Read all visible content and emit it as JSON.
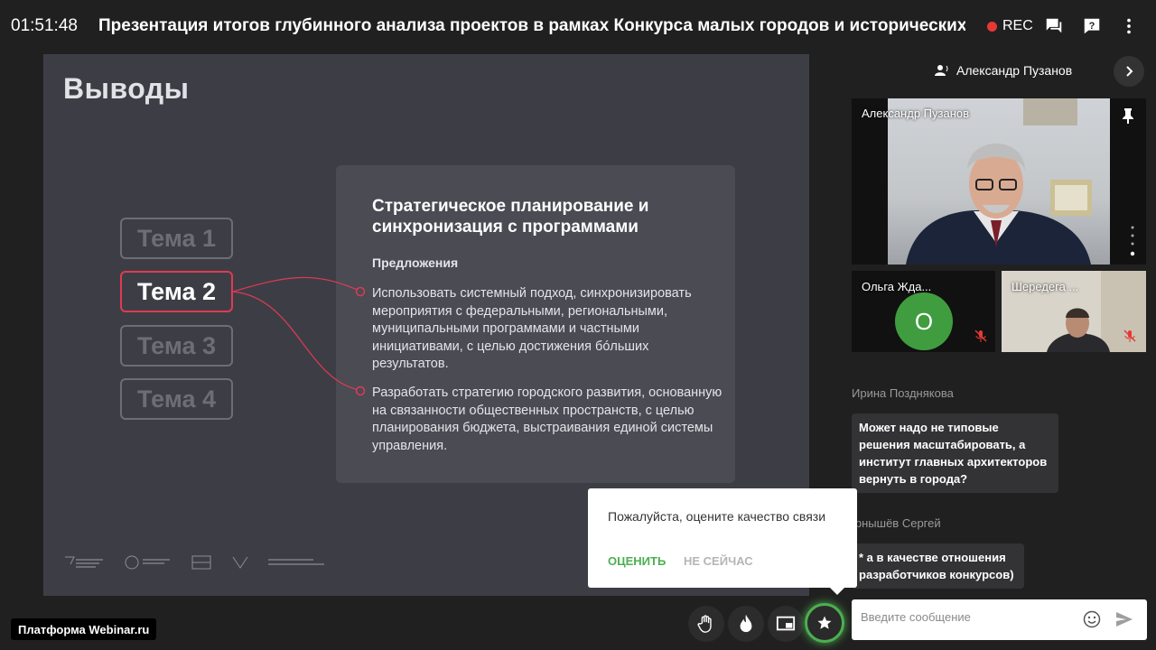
{
  "header": {
    "timer": "01:51:48",
    "title": "Презентация итогов глубинного анализа проектов в рамках Конкурса малых городов и исторических пос",
    "rec_label": "REC"
  },
  "slide": {
    "heading": "Выводы",
    "themes": [
      "Тема 1",
      "Тема 2",
      "Тема 3",
      "Тема 4"
    ],
    "active_theme": "Тема 2",
    "card": {
      "title": "Стратегическое планирование и синхронизация с программами",
      "subtitle": "Предложения",
      "proposals": [
        "Использовать системный подход, синхронизировать мероприятия с федеральными, региональными, муниципальными программами и частными инициативами, с целью достижения бóльших результатов.",
        "Разработать стратегию городского развития, основанную на связанности общественных пространств, с целью планирования бюджета, выстраивания единой системы управления."
      ]
    },
    "accent_color": "#e03a55"
  },
  "panel": {
    "speaker": "Александр Пузанов",
    "main_video_name": "Александр Пузанов",
    "tiles": [
      {
        "name": "Ольга Жда...",
        "avatar_letter": "О"
      },
      {
        "name": "Шередега ..."
      }
    ]
  },
  "chat": {
    "messages": [
      {
        "author": "Ирина Позднякова",
        "text": "Может надо не типовые решения масштабировать, а институт главных архитекторов вернуть в города?"
      },
      {
        "author": "Чернышёв Сергей",
        "text": "* а в качестве отношения разработчиков конкурсов)"
      }
    ],
    "input_placeholder": "Введите сообщение"
  },
  "rate_popup": {
    "text": "Пожалуйста, оцените качество связи",
    "rate_label": "ОЦЕНИТЬ",
    "later_label": "НЕ СЕЙЧАС"
  },
  "footer": {
    "platform_label": "Платформа Webinar.ru"
  },
  "colors": {
    "rec": "#e53935",
    "highlight_green": "#4caf50",
    "avatar_green": "#3f9d3f"
  }
}
